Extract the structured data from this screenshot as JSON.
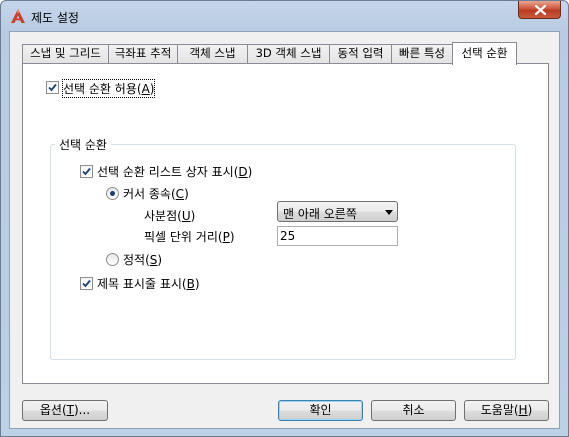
{
  "window": {
    "title": "제도 설정",
    "app_icon": "autocad-logo-icon",
    "close_icon": "close-x-icon",
    "accent_color": "#c8402a"
  },
  "tabs": [
    {
      "label": "스냅 및 그리드",
      "active": false
    },
    {
      "label": "극좌표 추적",
      "active": false
    },
    {
      "label": "객체 스냅",
      "active": false
    },
    {
      "label": "3D 객체 스냅",
      "active": false
    },
    {
      "label": "동적 입력",
      "active": false
    },
    {
      "label": "빠른 특성",
      "active": false
    },
    {
      "label": "선택 순환",
      "active": true
    }
  ],
  "panel": {
    "allow_cycling": {
      "label_pre": "선택 순환 허용(",
      "mnemonic": "A",
      "label_post": ")",
      "checked": true
    },
    "group_title": "선택 순환",
    "show_list_box": {
      "label_pre": "선택 순환 리스트 상자 표시(",
      "mnemonic": "D",
      "label_post": ")",
      "checked": true
    },
    "cursor_dependent": {
      "label_pre": "커서 종속(",
      "mnemonic": "C",
      "label_post": ")",
      "selected": true
    },
    "quadrant": {
      "label_pre": "사분점(",
      "mnemonic": "U",
      "label_post": ")",
      "value": "맨 아래 오른쪽"
    },
    "pixel_distance": {
      "label_pre": "픽셀 단위 거리(",
      "mnemonic": "P",
      "label_post": ")",
      "value": "25"
    },
    "static": {
      "label_pre": "정적(",
      "mnemonic": "S",
      "label_post": ")",
      "selected": false
    },
    "show_title_bar": {
      "label_pre": "제목 표시줄 표시(",
      "mnemonic": "B",
      "label_post": ")",
      "checked": true
    }
  },
  "buttons": {
    "options": {
      "label_pre": "옵션(",
      "mnemonic": "T",
      "label_post": ")..."
    },
    "ok": {
      "label": "확인"
    },
    "cancel": {
      "label": "취소"
    },
    "help": {
      "label_pre": "도움말(",
      "mnemonic": "H",
      "label_post": ")"
    }
  }
}
